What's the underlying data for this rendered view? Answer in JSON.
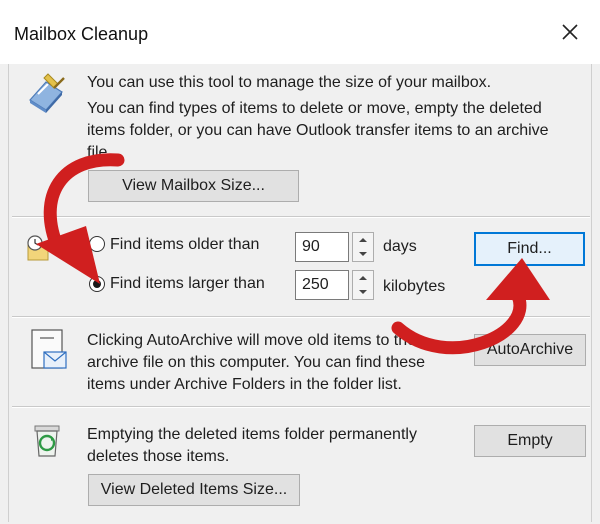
{
  "window": {
    "title": "Mailbox Cleanup",
    "close_glyph": "✕"
  },
  "section_size": {
    "line1": "You can use this tool to manage the size of your mailbox.",
    "line2": "You can find types of items to delete or move, empty the deleted",
    "line3": "items folder, or you can have Outlook transfer items to an archive",
    "line4": "file.",
    "view_size_button": "View Mailbox Size..."
  },
  "section_find": {
    "older_label": "Find items older than",
    "older_value": "90",
    "older_unit": "days",
    "older_selected": false,
    "larger_label": "Find items larger than",
    "larger_value": "250",
    "larger_unit": "kilobytes",
    "larger_selected": true,
    "find_button": "Find..."
  },
  "section_archive": {
    "line1": "Clicking AutoArchive will move old items to the",
    "line2": "archive file on this computer. You can find these",
    "line3": "items under Archive Folders in the folder list.",
    "autoarchive_button": "AutoArchive"
  },
  "section_deleted": {
    "line1": "Emptying the deleted items folder permanently",
    "line2": "deletes those items.",
    "empty_button": "Empty",
    "view_deleted_button": "View Deleted Items Size..."
  },
  "colors": {
    "annotation_arrow": "#d01f1f",
    "default_button_border": "#0078d7",
    "dialog_background": "#f0f0f0"
  },
  "icons": [
    "mailbox-cleanup-icon",
    "clock-calendar-icon",
    "autoarchive-envelope-icon",
    "recycle-bin-icon",
    "close-icon",
    "spin-up-icon",
    "spin-down-icon"
  ]
}
